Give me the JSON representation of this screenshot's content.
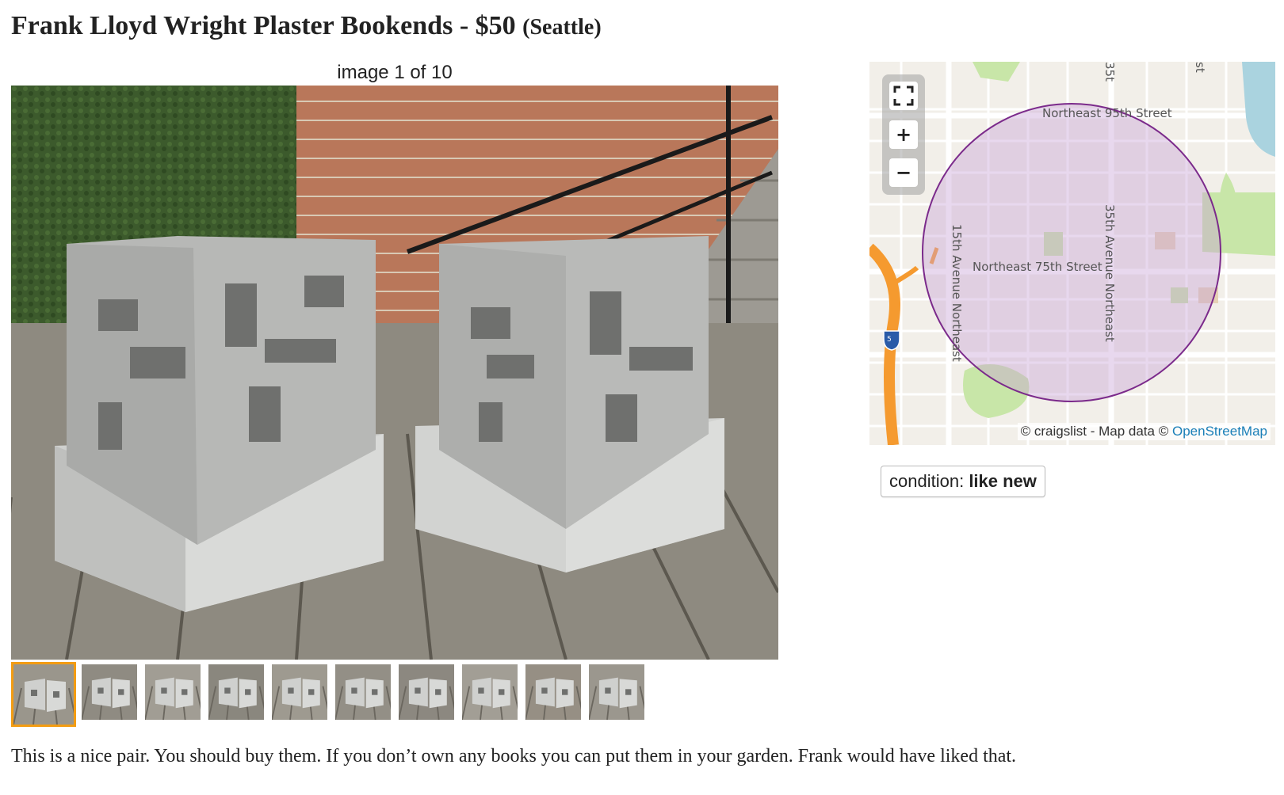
{
  "posting": {
    "title": "Frank Lloyd Wright Plaster Bookends - $50",
    "location": "(Seattle)"
  },
  "gallery": {
    "counter": "image 1 of 10",
    "thumbnail_count": 10,
    "active_index": 0
  },
  "map": {
    "streets": {
      "ne95": "Northeast 95th Street",
      "ne75": "Northeast 75th Street",
      "ave15": "15th Avenue Northeast",
      "ave35": "35th Avenue Northeast",
      "top_35": "35t",
      "top_right": "st"
    },
    "highway_shield": "5",
    "attribution_prefix": "© craigslist - Map data ©",
    "attribution_link": "OpenStreetMap",
    "controls": {
      "fullscreen": "fullscreen-icon",
      "zoom_in": "+",
      "zoom_out": "−"
    },
    "colors": {
      "area": "#c9a3d6",
      "area_stroke": "#7b2a8b",
      "highway": "#f59a2f",
      "water": "#aad3df",
      "park": "#c8e6a8"
    }
  },
  "attributes": {
    "condition_label": "condition:",
    "condition_value": "like new"
  },
  "description": "This is a nice pair. You should buy them. If you don’t own any books you can put them in your garden. Frank would have liked that."
}
